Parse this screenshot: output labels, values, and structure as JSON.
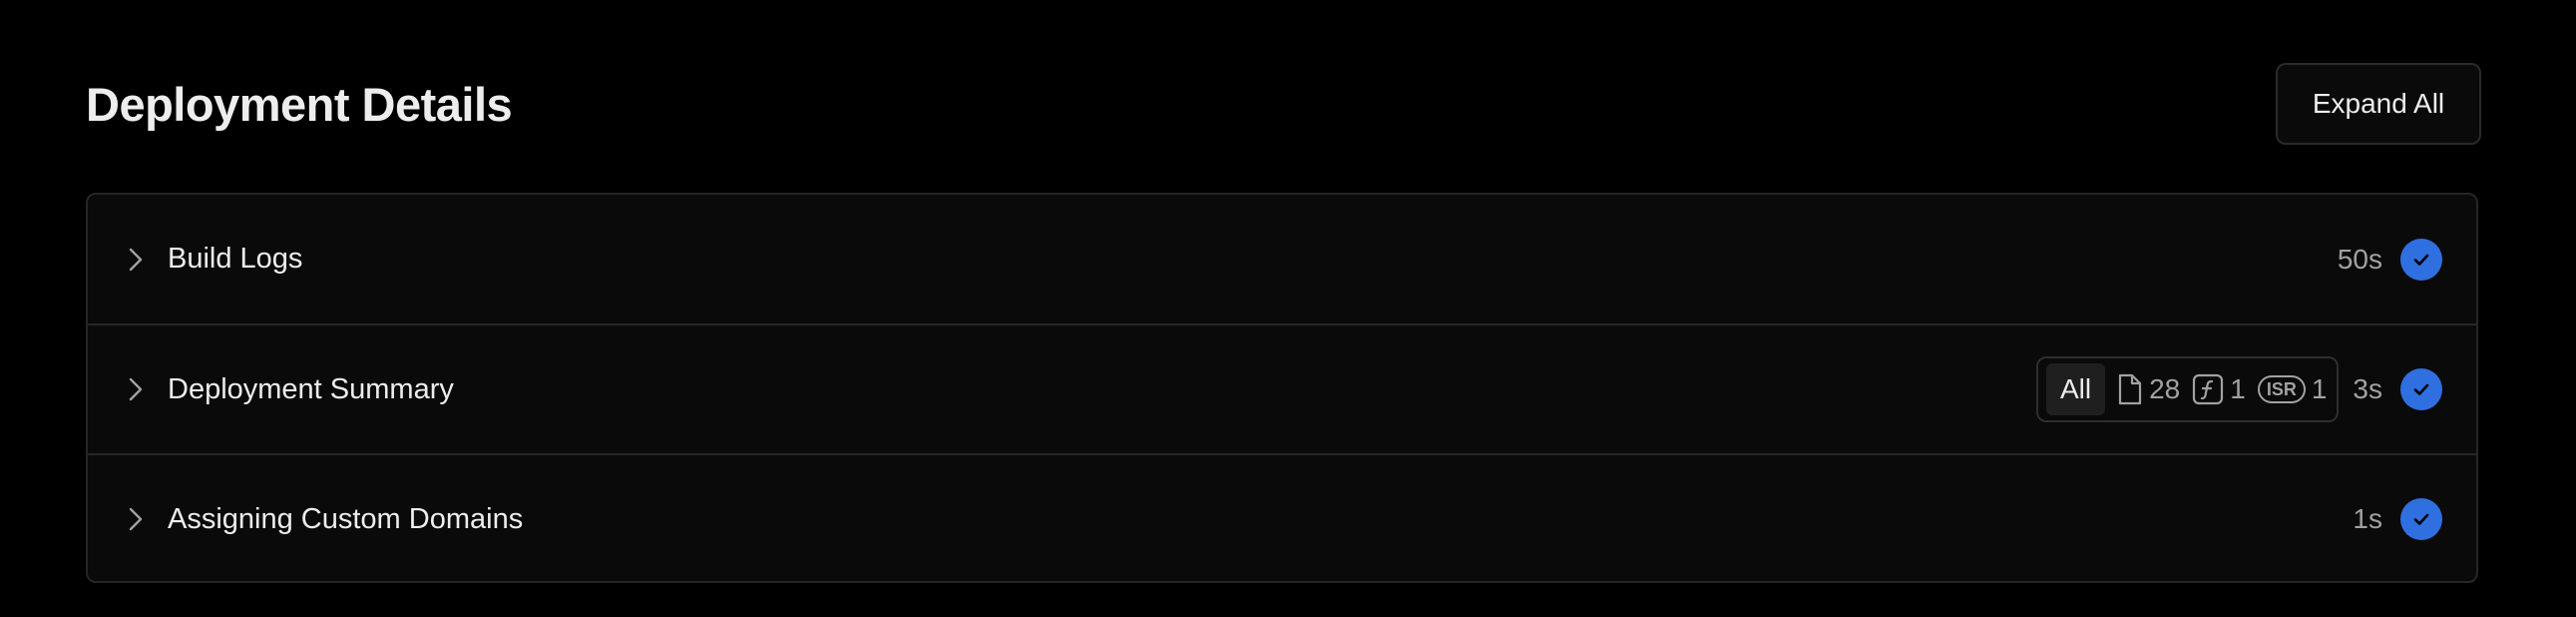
{
  "header": {
    "title": "Deployment Details",
    "expand_all_label": "Expand All"
  },
  "rows": [
    {
      "label": "Build Logs",
      "duration": "50s",
      "status": "success",
      "expanded": false
    },
    {
      "label": "Deployment Summary",
      "duration": "3s",
      "status": "success",
      "expanded": false,
      "filters": {
        "all_label": "All",
        "static_count": "28",
        "function_count": "1",
        "isr_label": "ISR",
        "isr_count": "1",
        "selected": "All"
      }
    },
    {
      "label": "Assigning Custom Domains",
      "duration": "1s",
      "status": "success",
      "expanded": false
    }
  ],
  "icons": {
    "chevron": "chevron-right-icon",
    "status": "check-circle-icon",
    "static_file": "file-icon",
    "function": "function-icon",
    "isr": "isr-icon"
  },
  "colors": {
    "background": "#000000",
    "panel": "#0a0a0a",
    "border": "#262626",
    "accent_success": "#2f6fe0",
    "text_primary": "#ededed",
    "text_secondary": "#a1a1a1"
  }
}
